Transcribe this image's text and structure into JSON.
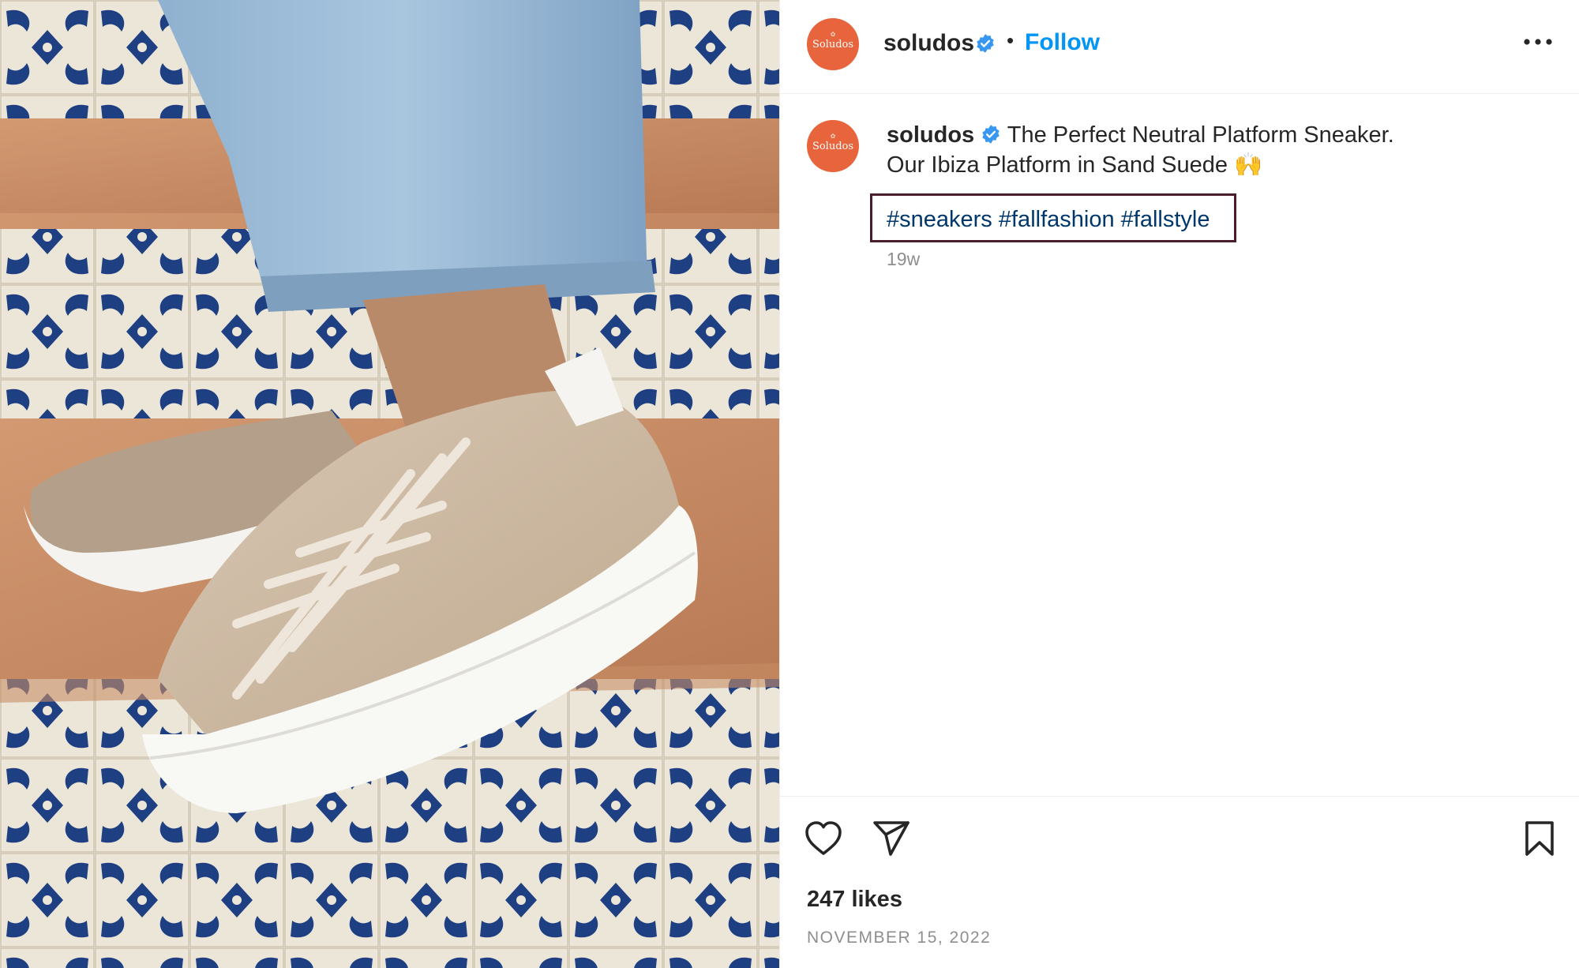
{
  "post": {
    "image_alt": "Feet wearing beige suede platform sneakers on tiled steps",
    "author": {
      "username": "soludos",
      "avatar_text": "Soludos",
      "verified": true
    },
    "header": {
      "separator": "•",
      "follow_label": "Follow",
      "more_icon": "more-horizontal-icon"
    },
    "caption": {
      "username": "soludos",
      "line1": "The Perfect Neutral Platform Sneaker.",
      "line2": "Our Ibiza Platform in Sand Suede 🙌",
      "hashtags": [
        "#sneakers",
        "#fallfashion",
        "#fallstyle"
      ],
      "age": "19w"
    },
    "actions": {
      "like_icon": "heart-icon",
      "share_icon": "paper-plane-icon",
      "save_icon": "bookmark-icon"
    },
    "likes": "247 likes",
    "date": "NOVEMBER 15, 2022"
  },
  "colors": {
    "accent_link": "#0095f6",
    "hashtag": "#00376b",
    "avatar_bg": "#e8643c",
    "highlight_box": "#4a1c2c",
    "verified_badge": "#3897f0"
  }
}
